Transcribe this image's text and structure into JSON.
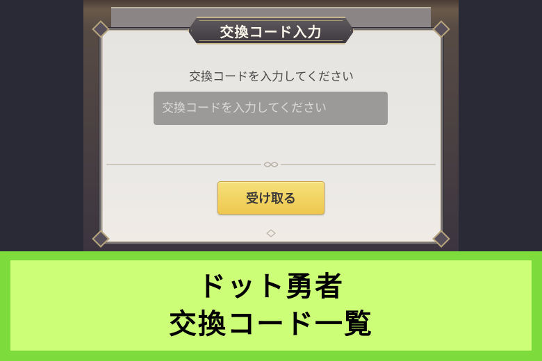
{
  "dialog": {
    "title": "交換コード入力",
    "instruction": "交換コードを入力してください",
    "code_input": {
      "value": "",
      "placeholder": "交換コードを入力してください"
    },
    "receive_button_label": "受け取る"
  },
  "banner": {
    "line1": "ドット勇者",
    "line2": "交換コード一覧"
  },
  "colors": {
    "banner_border": "#7ddc3c",
    "banner_fill": "#ccff77",
    "button_yellow": "#f0d060",
    "title_plate": "#4a454a",
    "dialog_bg": "#e9e7e4",
    "input_bg": "#9c9a99"
  },
  "icons": [
    "corner-ornament-icon",
    "divider-ornament-icon"
  ]
}
